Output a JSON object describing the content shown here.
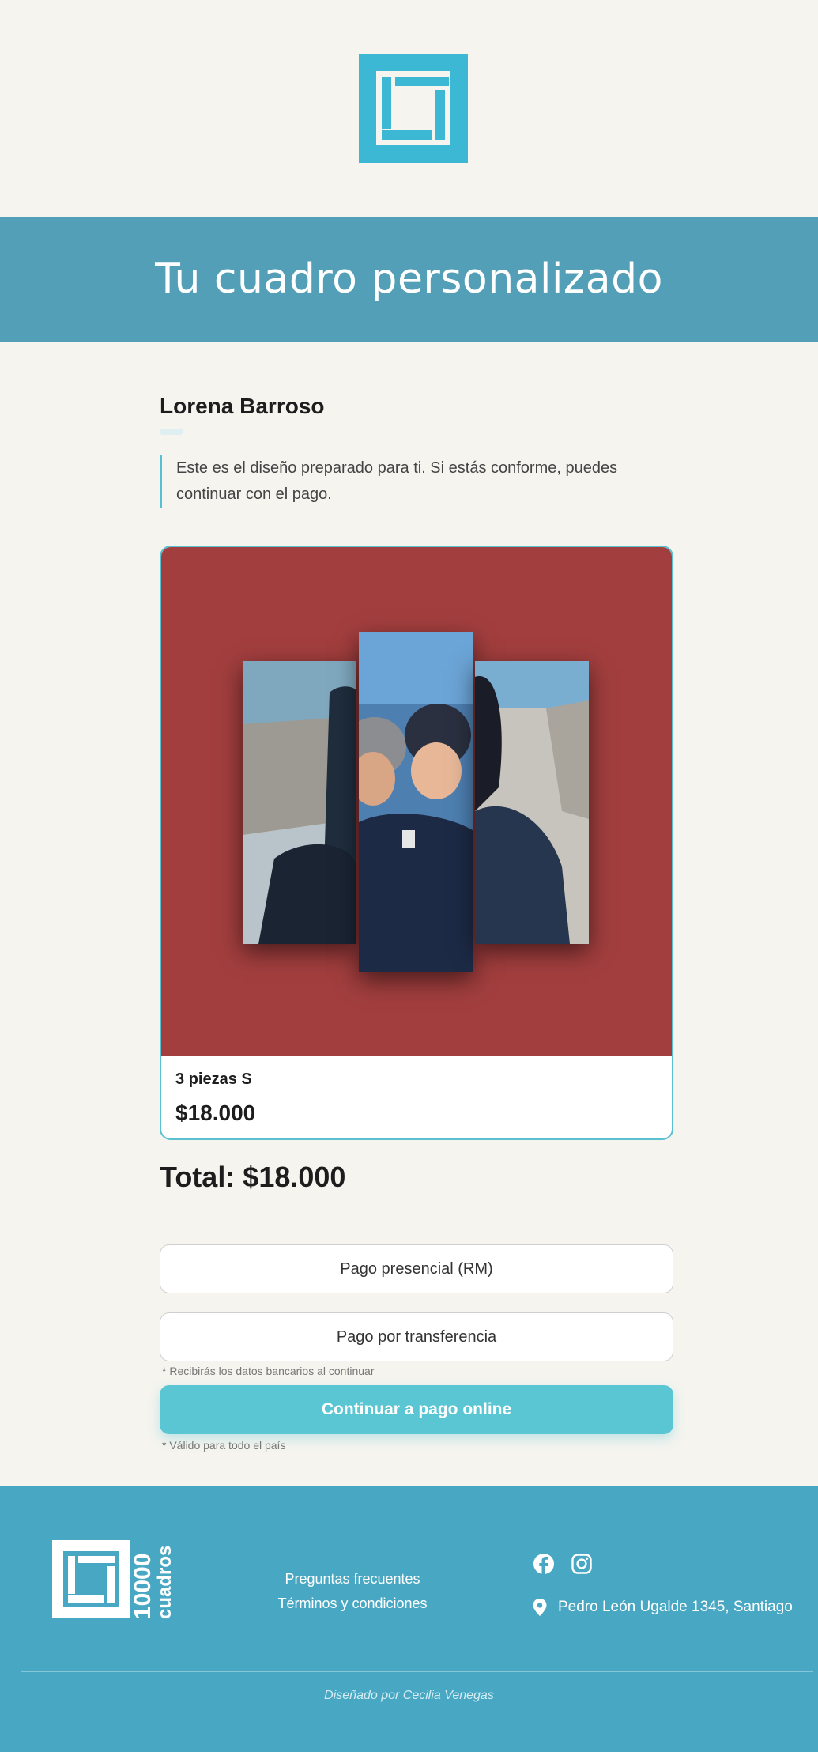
{
  "brand": {
    "logo_icon": "square-frame-logo",
    "footer_logo_text": "10000 cuadros",
    "accent": "#5ac6d4",
    "hero_bg": "#529fb7",
    "footer_bg": "#48a8c3",
    "preview_bg": "#a23e3e"
  },
  "hero": {
    "title": "Tu cuadro personalizado"
  },
  "client": {
    "name": "Lorena Barroso",
    "note": "Este es el diseño preparado para ti. Si estás conforme, puedes continuar con el pago."
  },
  "product": {
    "name": "3 piezas S",
    "price": "$18.000"
  },
  "total": "Total: $18.000",
  "payment": {
    "in_person": "Pago presencial (RM)",
    "transfer": "Pago por transferencia",
    "transfer_note": "* Recibirás los datos bancarios al continuar",
    "online": "Continuar a pago online",
    "online_note": "* Válido para todo el país"
  },
  "footer": {
    "links": [
      "Preguntas frecuentes",
      "Términos y condiciones"
    ],
    "social_icons": [
      "facebook-icon",
      "instagram-icon"
    ],
    "address_icon": "location-pin-icon",
    "address": "Pedro León Ugalde 1345, Santiago",
    "credit": "Diseñado por Cecilia Venegas"
  }
}
